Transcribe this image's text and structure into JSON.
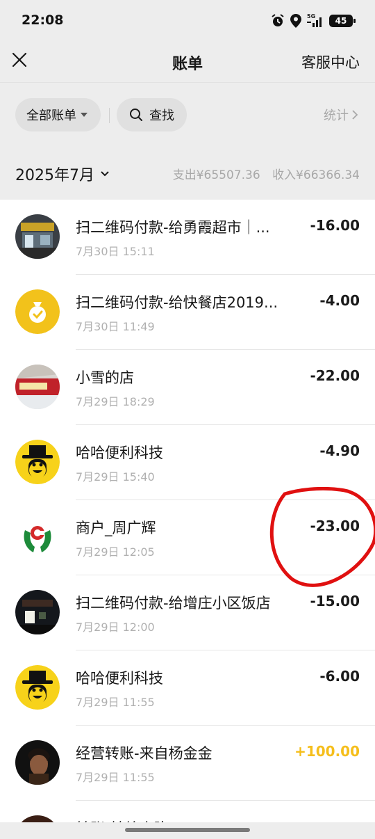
{
  "status_bar": {
    "time": "22:08",
    "network": "5G",
    "battery": "45",
    "icons": [
      "alarm-icon",
      "location-icon",
      "signal-icon",
      "battery-icon"
    ]
  },
  "nav": {
    "close_icon": "close-icon",
    "title": "账单",
    "service": "客服中心"
  },
  "filters": {
    "all_bills": "全部账单",
    "search": "查找",
    "stats": "统计"
  },
  "month": {
    "label": "2025年7月",
    "expense": "支出¥65507.36",
    "income": "收入¥66366.34"
  },
  "colors": {
    "income_amount": "#f5be1b",
    "background": "#ededed",
    "annotation": "#e01010"
  },
  "transactions": [
    {
      "title": "扫二维码付款-给勇霞超市｜...",
      "time": "7月30日 15:11",
      "amount": "-16.00",
      "avatar": "store-photo-avatar"
    },
    {
      "title": "扫二维码付款-给快餐店2019...",
      "time": "7月30日 11:49",
      "amount": "-4.00",
      "avatar": "money-bag-icon"
    },
    {
      "title": "小雪的店",
      "time": "7月29日 18:29",
      "amount": "-22.00",
      "avatar": "storefront-sign-avatar"
    },
    {
      "title": "哈哈便利科技",
      "time": "7月29日 15:40",
      "amount": "-4.90",
      "avatar": "hat-smiley-avatar"
    },
    {
      "title": "商户_周广辉",
      "time": "7月29日 12:05",
      "amount": "-23.00",
      "avatar": "bank-logo-avatar"
    },
    {
      "title": "扫二维码付款-给增庄小区饭店",
      "time": "7月29日 12:00",
      "amount": "-15.00",
      "avatar": "night-store-avatar"
    },
    {
      "title": "哈哈便利科技",
      "time": "7月29日 11:55",
      "amount": "-6.00",
      "avatar": "hat-smiley-avatar"
    },
    {
      "title": "经营转账-来自杨金金",
      "time": "7月29日 11:55",
      "amount": "+100.00",
      "avatar": "portrait-avatar"
    },
    {
      "title": "转账-转给小陈",
      "time": "",
      "amount": "",
      "avatar": "portrait-avatar"
    }
  ]
}
